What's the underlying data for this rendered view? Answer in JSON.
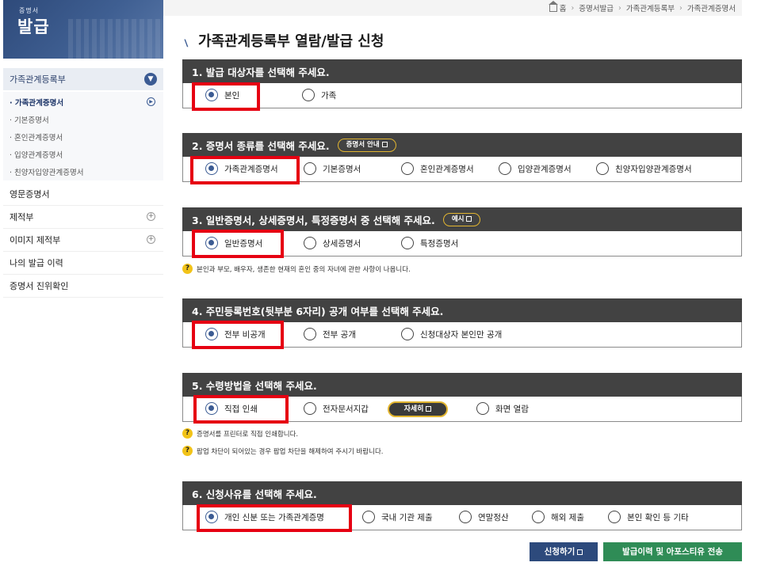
{
  "logo": {
    "small": "증명서",
    "big": "발급"
  },
  "sidebar": {
    "main": "가족관계등록부",
    "subitems": [
      "· 가족관계증명서",
      "· 기본증명서",
      "· 혼인관계증명서",
      "· 입양관계증명서",
      "· 친양자입양관계증명서"
    ],
    "rows": [
      "영문증명서",
      "제적부",
      "이미지 제적부",
      "나의 발급 이력",
      "증명서 진위확인"
    ]
  },
  "breadcrumb": [
    "홈",
    "증명서발급",
    "가족관계등록부",
    "가족관계증명서"
  ],
  "page_title": "가족관계등록부 열람/발급 신청",
  "sections": [
    {
      "title": "1. 발급 대상자를 선택해 주세요.",
      "options": [
        "본인",
        "가족"
      ]
    },
    {
      "title": "2. 증명서 종류를 선택해 주세요.",
      "pill": "증명서 안내",
      "options": [
        "가족관계증명서",
        "기본증명서",
        "혼인관계증명서",
        "입양관계증명서",
        "친양자입양관계증명서"
      ]
    },
    {
      "title": "3. 일반증명서, 상세증명서, 특정증명서 중 선택해 주세요.",
      "pill": "예시",
      "options": [
        "일반증명서",
        "상세증명서",
        "특정증명서"
      ]
    },
    {
      "title": "4. 주민등록번호(뒷부분 6자리) 공개 여부를 선택해 주세요.",
      "options": [
        "전부 비공개",
        "전부 공개",
        "신청대상자 본인만 공개"
      ]
    },
    {
      "title": "5. 수령방법을 선택해 주세요.",
      "options": [
        "직접 인쇄",
        "전자문서지갑",
        "화면 열람"
      ],
      "detail": "자세히"
    },
    {
      "title": "6. 신청사유를 선택해 주세요.",
      "options": [
        "개인 신분 또는 가족관계증명",
        "국내 기관 제출",
        "연말정산",
        "해외 제출",
        "본인 확인 등 기타"
      ]
    }
  ],
  "notes": {
    "s3": "본인과 부모, 배우자, 생존한 현재의 혼인 중의 자녀에 관한 사항이 나옵니다.",
    "s5a": "증명서를 프린터로 직접 인쇄합니다.",
    "s5b": "팝업 차단이 되어있는 경우 팝업 차단을 해제하여 주시기 바랍니다."
  },
  "buttons": {
    "apply": "신청하기",
    "send": "발급이력 및 아포스티유 전송"
  }
}
